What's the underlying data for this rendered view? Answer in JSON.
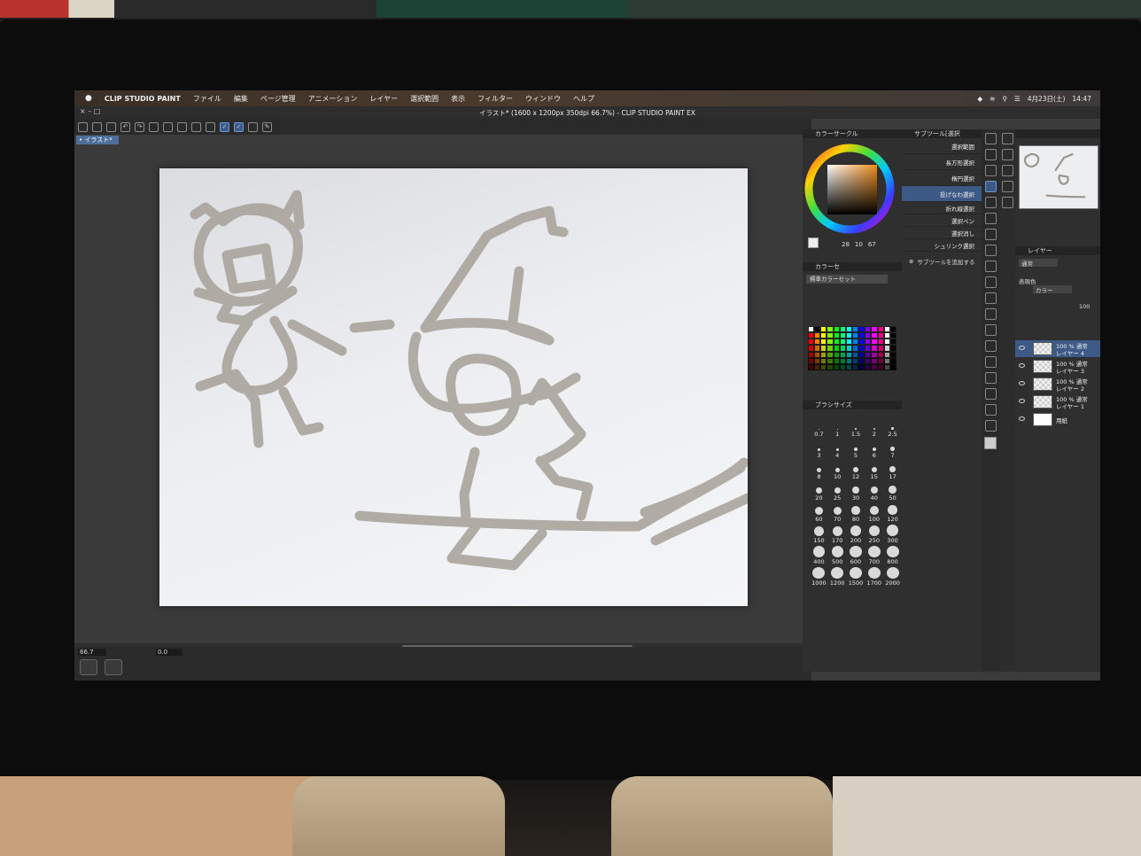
{
  "menubar": {
    "apple": "",
    "app_name": "CLIP STUDIO PAINT",
    "items": [
      "ファイル",
      "編集",
      "ページ管理",
      "アニメーション",
      "レイヤー",
      "選択範囲",
      "表示",
      "フィルター",
      "ウィンドウ",
      "ヘルプ"
    ],
    "date": "4月23日(土)",
    "time": "14:47"
  },
  "window": {
    "title": "イラスト* (1600 x 1200px 350dpi 66.7%) - CLIP STUDIO PAINT EX",
    "controls": "× – □",
    "canvas_tab": "• イラスト*"
  },
  "footer": {
    "zoom": "66.7",
    "rotation": "0.0"
  },
  "color_panel": {
    "title": "カラーサークル",
    "readout": [
      "28",
      "10",
      "67"
    ],
    "set_tab": "カラーセ",
    "set_name": "標準カラーセット",
    "main_color": "#ef8c1c"
  },
  "brush_size": {
    "title": "ブラシサイズ",
    "sizes": [
      "0.7",
      "1",
      "1.5",
      "2",
      "2.5",
      "3",
      "4",
      "5",
      "6",
      "7",
      "8",
      "10",
      "12",
      "15",
      "17",
      "20",
      "25",
      "30",
      "40",
      "50",
      "60",
      "70",
      "80",
      "100",
      "120",
      "150",
      "170",
      "200",
      "250",
      "300",
      "400",
      "500",
      "600",
      "700",
      "800",
      "1000",
      "1200",
      "1500",
      "1700",
      "2000"
    ]
  },
  "subtool": {
    "title": "サブツール[選択",
    "items": [
      "選択範囲",
      "長方形選択",
      "楕円選択",
      "投げなわ選択",
      "折れ線選択",
      "選択ペン",
      "選択消し",
      "シュリンク選択"
    ],
    "selected": 3,
    "add_label": "サブツールを追加する"
  },
  "layers": {
    "title": "レイヤー",
    "blend": "通常",
    "color_label": "表現色",
    "color_value": "カラー",
    "opacity": "100",
    "list": [
      {
        "pct": "100 % 通常",
        "name": "レイヤー 4",
        "selected": true
      },
      {
        "pct": "100 % 通常",
        "name": "レイヤー 3",
        "selected": false
      },
      {
        "pct": "100 % 通常",
        "name": "レイヤー 2",
        "selected": false
      },
      {
        "pct": "100 % 通常",
        "name": "レイヤー 1",
        "selected": false
      },
      {
        "pct": "",
        "name": "用紙",
        "selected": false
      }
    ]
  },
  "palette_colors": [
    "#ff0000",
    "#ff8000",
    "#ffff00",
    "#80ff00",
    "#00ff00",
    "#00ff80",
    "#00ffff",
    "#0080ff",
    "#0000ff",
    "#8000ff",
    "#ff00ff",
    "#ff0080",
    "#ffffff",
    "#000000"
  ]
}
